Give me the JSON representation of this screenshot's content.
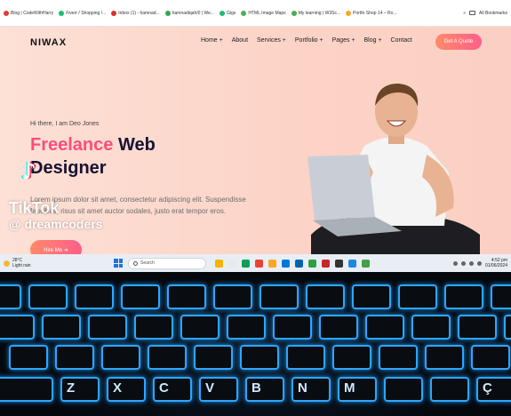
{
  "bookmarks": [
    {
      "label": "Blog | CodeWithHarry",
      "color": "#e53935"
    },
    {
      "label": "Fiverr / Shopping /...",
      "color": "#1dbf73"
    },
    {
      "label": "Inbox (1) - hamnad...",
      "color": "#d93025"
    },
    {
      "label": "hamnadiqah/0 | We...",
      "color": "#34a853"
    },
    {
      "label": "Gigs",
      "color": "#1dbf73"
    },
    {
      "label": "HTML Image Maps",
      "color": "#4caf50"
    },
    {
      "label": "My learning | W3Sc...",
      "color": "#4caf50"
    },
    {
      "label": "Portfo Shop 14 – Ro...",
      "color": "#f9a825"
    }
  ],
  "bookmarks_right": {
    "more": "»",
    "all": "All Bookmarks"
  },
  "site": {
    "logo": "NIWAX",
    "nav": [
      "Home +",
      "About",
      "Services +",
      "Portfolio +",
      "Pages +",
      "Blog +",
      "Contact"
    ],
    "quote_button": "Get A Quote",
    "greeting": "Hi there, I am Deo Jones",
    "headline_accent": "Freelance",
    "headline_rest": " Web Designer",
    "description": "Lorem ipsum dolor sit amet, consectetur adipiscing elit. Suspendisse faucibus, risus sit amet auctor sodales, justo erat tempor eros.",
    "cta": "Hire Me ➜"
  },
  "overlay": {
    "brand": "TikTok",
    "username": "@ dreamcoders",
    "logo_glyph": "♪"
  },
  "taskbar": {
    "temp": "28°C",
    "weather": "Light rain",
    "search_placeholder": "Search",
    "time": "4:52 pm",
    "date": "01/06/2024",
    "app_colors": [
      "#f4b400",
      "#e8eaed",
      "#0f9d58",
      "#ea4335",
      "#f9a825",
      "#0078d7",
      "#0063b1",
      "#2ea043",
      "#c62828",
      "#333333",
      "#1e88e5",
      "#43a047"
    ]
  },
  "keyboard_rows": [
    [
      "",
      "",
      "",
      "",
      "",
      "",
      "",
      "",
      "",
      "",
      "",
      "",
      ""
    ],
    [
      "",
      "",
      "",
      "",
      "",
      "",
      "",
      "",
      "",
      "",
      "",
      ""
    ],
    [
      "",
      "",
      "",
      "",
      "",
      "",
      "",
      "",
      "",
      "",
      "",
      ""
    ],
    [
      "",
      "Z",
      "X",
      "C",
      "V",
      "B",
      "N",
      "M",
      "",
      "",
      "Ç"
    ]
  ]
}
